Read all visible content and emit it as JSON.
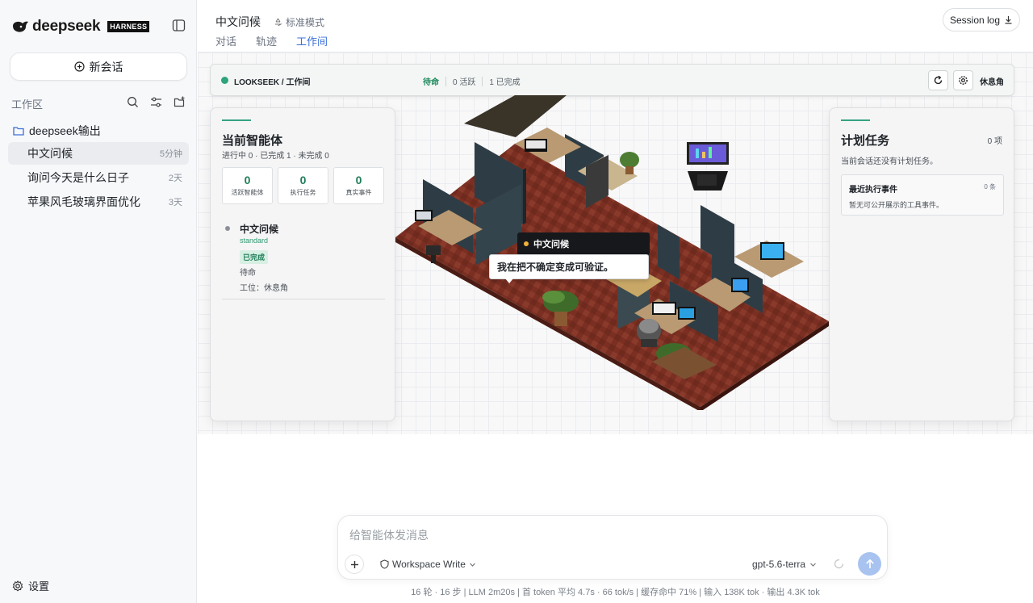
{
  "brand": {
    "name": "deepseek",
    "badge": "HARNESS"
  },
  "sidebar": {
    "new_chat": "新会话",
    "workspace_label": "工作区",
    "folder": "deepseek输出",
    "conversations": [
      {
        "title": "中文问候",
        "time": "5分钟",
        "active": true
      },
      {
        "title": "询问今天是什么日子",
        "time": "2天",
        "active": false
      },
      {
        "title": "苹果风毛玻璃界面优化",
        "time": "3天",
        "active": false
      }
    ],
    "settings": "设置"
  },
  "header": {
    "title": "中文问候",
    "mode": "标准模式",
    "tabs": [
      {
        "label": "对话",
        "active": false
      },
      {
        "label": "轨迹",
        "active": false
      },
      {
        "label": "工作间",
        "active": true
      }
    ],
    "session_log": "Session log"
  },
  "status_bar": {
    "label": "LOOKSEEK / 工作间",
    "state": "待命",
    "active_count": "0 活跃",
    "done_count": "1 已完成",
    "rest": "休息角"
  },
  "left_panel": {
    "title": "当前智能体",
    "summary": "进行中 0 · 已完成 1 · 未完成 0",
    "stats": [
      {
        "value": "0",
        "label": "活跃智能体"
      },
      {
        "value": "0",
        "label": "执行任务"
      },
      {
        "value": "0",
        "label": "真实事件"
      }
    ],
    "agent": {
      "name": "中文问候",
      "type": "standard",
      "badge": "已完成",
      "status": "待命",
      "position": "工位：休息角"
    }
  },
  "right_panel": {
    "title": "计划任务",
    "count": "0 项",
    "empty": "当前会话还没有计划任务。",
    "event_title": "最近执行事件",
    "event_count": "0 条",
    "event_desc": "暂无可公开展示的工具事件。"
  },
  "scene": {
    "agent_tag": "中文问候",
    "bubble": "我在把不确定变成可验证。"
  },
  "composer": {
    "placeholder": "给智能体发消息",
    "workspace": "Workspace Write",
    "model": "gpt-5.6-terra"
  },
  "footer": "16 轮 · 16 步   |   LLM 2m20s   |   首 token 平均 4.7s · 66 tok/s   |   缓存命中 71%   |   输入 138K tok · 输出 4.3K tok",
  "colors": {
    "accent": "#3b6fd8",
    "green": "#1f7d5a",
    "floor": "#7a2f22"
  }
}
